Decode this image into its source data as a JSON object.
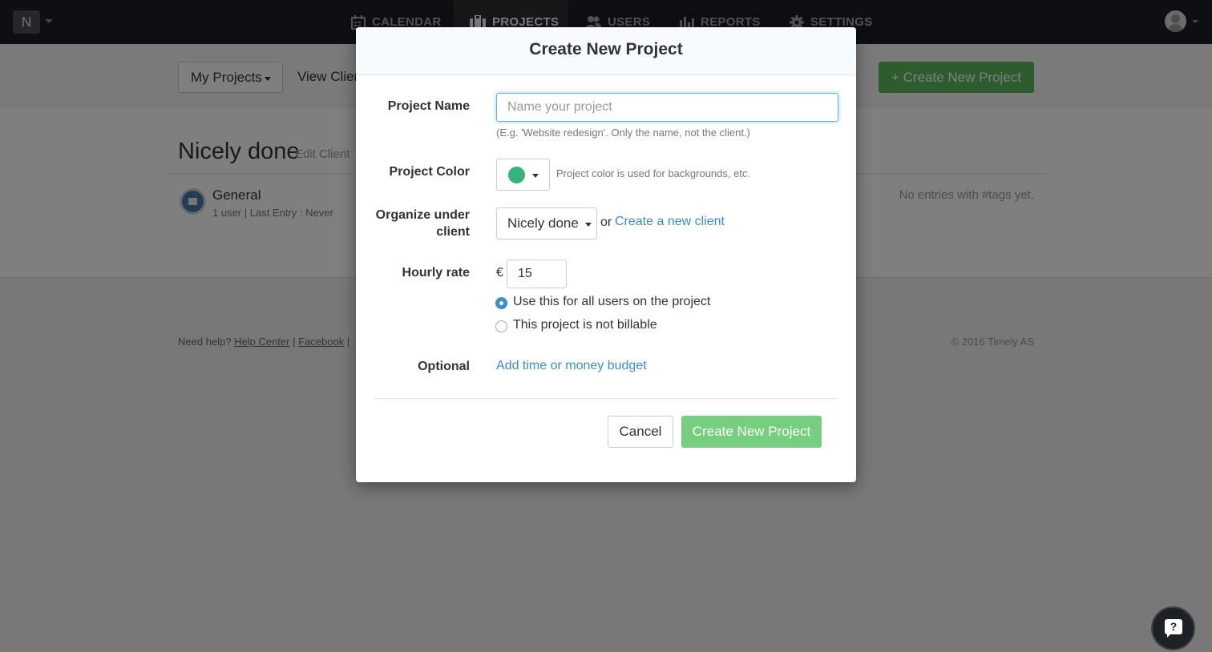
{
  "topnav": {
    "workspace_initial": "N",
    "tabs": [
      {
        "label": "CALENDAR",
        "icon": "calendar-icon",
        "active": false
      },
      {
        "label": "PROJECTS",
        "icon": "briefcase-icon",
        "active": true
      },
      {
        "label": "USERS",
        "icon": "users-icon",
        "active": false
      },
      {
        "label": "REPORTS",
        "icon": "bar-chart-icon",
        "active": false
      },
      {
        "label": "SETTINGS",
        "icon": "gear-icon",
        "active": false
      }
    ]
  },
  "subheader": {
    "my_projects_label": "My Projects",
    "view_clients_label": "View Clients",
    "create_button_label": "Create New Project"
  },
  "main": {
    "client_name": "Nicely done",
    "edit_client_label": "Edit Client",
    "project": {
      "name": "General",
      "meta": "1 user | Last Entry : Never"
    },
    "tags_message": "No entries with #tags yet."
  },
  "footer": {
    "help_prefix": "Need help?",
    "help_center": "Help Center",
    "separator": "|",
    "facebook": "Facebook",
    "copyright": "© 2016 Timely AS"
  },
  "modal": {
    "title": "Create New Project",
    "labels": {
      "project_name": "Project Name",
      "project_color": "Project Color",
      "organize_line1": "Organize under",
      "organize_line2": "client",
      "hourly_rate": "Hourly rate",
      "optional": "Optional"
    },
    "project_name_placeholder": "Name your project",
    "project_name_value": "",
    "project_name_help": "(E.g. 'Website redesign'. Only the name, not the client.)",
    "color_value": "#37b27a",
    "color_hint": "Project color is used for backgrounds, etc.",
    "client_selected": "Nicely done",
    "or_text": "or",
    "create_client_link": "Create a new client",
    "currency_symbol": "€",
    "hourly_rate_value": "15",
    "rate_options": [
      {
        "label": "Use this for all users on the project",
        "checked": true
      },
      {
        "label": "This project is not billable",
        "checked": false
      }
    ],
    "budget_link": "Add time or money budget",
    "cancel_label": "Cancel",
    "submit_label": "Create New Project"
  },
  "colors": {
    "accent_green": "#5cb85c",
    "submit_green": "#76cf7f",
    "link_blue": "#3c8dc9",
    "nav_bg": "#1c1f24"
  }
}
